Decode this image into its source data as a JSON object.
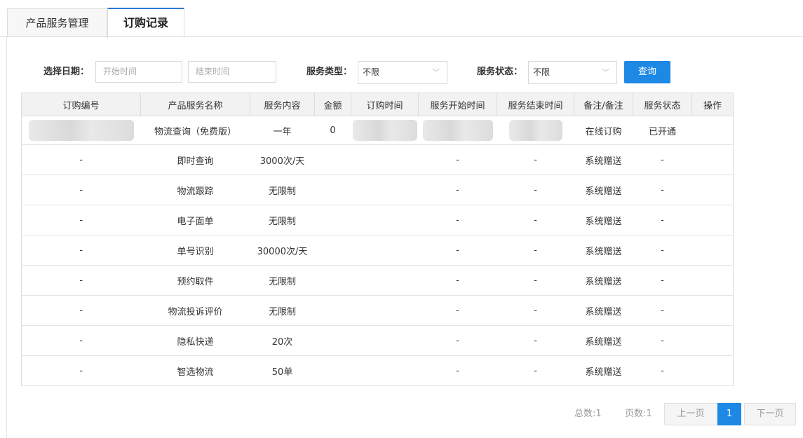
{
  "tabs": [
    {
      "label": "产品服务管理"
    },
    {
      "label": "订购记录"
    }
  ],
  "filters": {
    "date_label": "选择日期：",
    "start_placeholder": "开始时间",
    "end_placeholder": "结束时间",
    "type_label": "服务类型：",
    "type_value": "不限",
    "status_label": "服务状态：",
    "status_value": "不限",
    "query_label": "查询"
  },
  "table": {
    "headers": [
      "订购编号",
      "产品服务名称",
      "服务内容",
      "金额",
      "订购时间",
      "服务开始时间",
      "服务结束时间",
      "备注/备注",
      "服务状态",
      "操作"
    ],
    "first_row": {
      "name": "物流查询（免费版）",
      "content": "一年",
      "amount": "0",
      "remark": "在线订购",
      "status": "已开通"
    },
    "rows": [
      {
        "id": "-",
        "name": "即时查询",
        "content": "3000次/天",
        "start": "-",
        "end": "-",
        "remark": "系统赠送",
        "status": "-"
      },
      {
        "id": "-",
        "name": "物流跟踪",
        "content": "无限制",
        "start": "-",
        "end": "-",
        "remark": "系统赠送",
        "status": "-"
      },
      {
        "id": "-",
        "name": "电子面单",
        "content": "无限制",
        "start": "-",
        "end": "-",
        "remark": "系统赠送",
        "status": "-"
      },
      {
        "id": "-",
        "name": "单号识别",
        "content": "30000次/天",
        "start": "-",
        "end": "-",
        "remark": "系统赠送",
        "status": "-"
      },
      {
        "id": "-",
        "name": "预约取件",
        "content": "无限制",
        "start": "-",
        "end": "-",
        "remark": "系统赠送",
        "status": "-"
      },
      {
        "id": "-",
        "name": "物流投诉评价",
        "content": "无限制",
        "start": "-",
        "end": "-",
        "remark": "系统赠送",
        "status": "-"
      },
      {
        "id": "-",
        "name": "隐私快递",
        "content": "20次",
        "start": "-",
        "end": "-",
        "remark": "系统赠送",
        "status": "-"
      },
      {
        "id": "-",
        "name": "智选物流",
        "content": "50单",
        "start": "-",
        "end": "-",
        "remark": "系统赠送",
        "status": "-"
      }
    ]
  },
  "pager": {
    "total": "总数:1",
    "pages": "页数:1",
    "prev": "上一页",
    "current": "1",
    "next": "下一页"
  }
}
